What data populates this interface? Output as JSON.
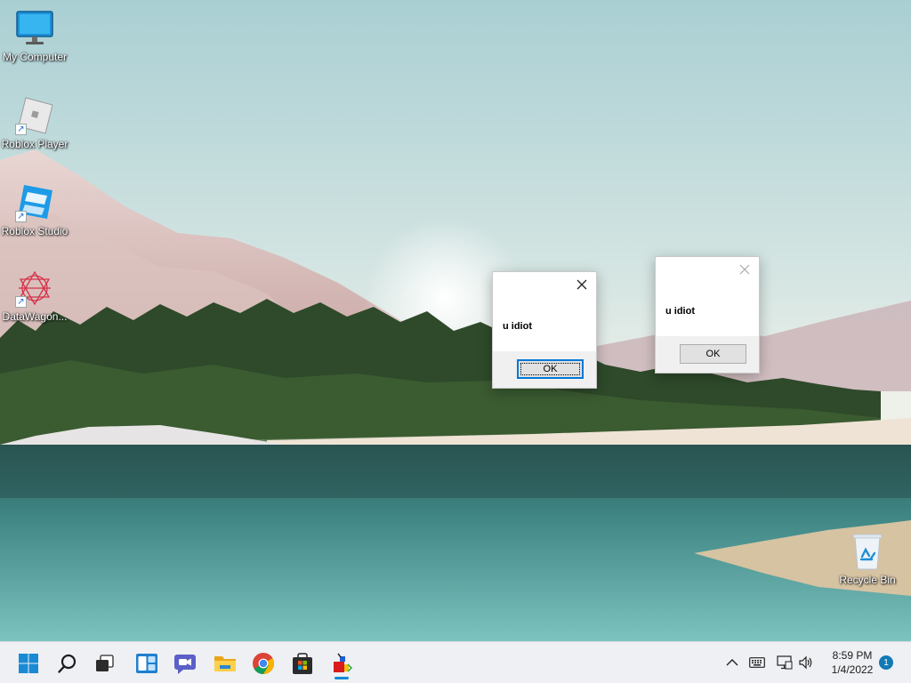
{
  "desktop": {
    "icons": [
      {
        "label": "My Computer"
      },
      {
        "label": "Roblox Player"
      },
      {
        "label": "Roblox Studio"
      },
      {
        "label": "DataWagon..."
      },
      {
        "label": "Recycle Bin"
      }
    ]
  },
  "dialogs": [
    {
      "message": "u idiot",
      "ok_label": "OK"
    },
    {
      "message": "u idiot",
      "ok_label": "OK"
    }
  ],
  "taskbar": {
    "pinned": [
      "start-icon",
      "search-icon",
      "task-view-icon",
      "widgets-icon",
      "chat-icon",
      "file-explorer-icon",
      "chrome-icon",
      "store-icon",
      "running-app-icon"
    ],
    "tray": {
      "time": "8:59 PM",
      "date": "1/4/2022",
      "notification_count": "1"
    }
  },
  "colors": {
    "accent": "#0078d7",
    "taskbar_bg": "#eef0f3"
  }
}
